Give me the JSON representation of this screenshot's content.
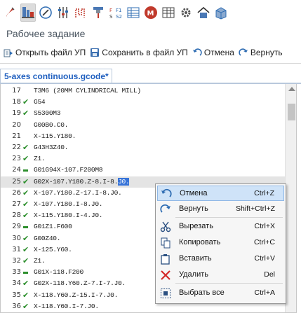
{
  "toolbar_icons": [
    {
      "name": "paint-brush-icon",
      "active": false
    },
    {
      "name": "machine-tool-icon",
      "active": true
    },
    {
      "name": "compass-gauge-icon",
      "active": false
    },
    {
      "name": "sliders-icon",
      "active": false
    },
    {
      "name": "toolpath-icon",
      "active": false
    },
    {
      "name": "tool-holder-icon",
      "active": false
    },
    {
      "name": "feed-speed-icon",
      "active": false
    },
    {
      "name": "table-list-icon",
      "active": false
    },
    {
      "name": "m-code-icon",
      "active": false
    },
    {
      "name": "table-grid-icon",
      "active": false
    },
    {
      "name": "gear-settings-icon",
      "active": false
    },
    {
      "name": "house-icon",
      "active": false
    },
    {
      "name": "stock-block-icon",
      "active": false
    }
  ],
  "section_title": "Рабочее задание",
  "actions": {
    "open": "Открыть файл УП",
    "save": "Сохранить в файл УП",
    "undo": "Отмена",
    "redo": "Вернуть"
  },
  "tab": {
    "title": "5-axes continuous.gcode*"
  },
  "editor": {
    "lines": [
      {
        "num": "17",
        "mark": "",
        "code": "T3M6 (20MM CYLINDRICAL MILL)"
      },
      {
        "num": "18",
        "mark": "ok",
        "code": "G54"
      },
      {
        "num": "19",
        "mark": "ok",
        "code": "S5300M3"
      },
      {
        "num": "20",
        "mark": "",
        "code": "G00B0.C0."
      },
      {
        "num": "21",
        "mark": "",
        "code": "X-115.Y180."
      },
      {
        "num": "22",
        "mark": "ok",
        "code": "G43H3Z40."
      },
      {
        "num": "23",
        "mark": "ok",
        "code": "Z1."
      },
      {
        "num": "24",
        "mark": "dash",
        "code": "G01G94X-107.F200M8"
      },
      {
        "num": "25",
        "mark": "ok",
        "code": "G02X-107.Y180.Z-8.I-8.",
        "selected": "J0."
      },
      {
        "num": "26",
        "mark": "ok",
        "code": "X-107.Y180.Z-17.I-8.J0."
      },
      {
        "num": "27",
        "mark": "ok",
        "code": "X-107.Y180.I-8.J0."
      },
      {
        "num": "28",
        "mark": "ok",
        "code": "X-115.Y180.I-4.J0."
      },
      {
        "num": "29",
        "mark": "dash",
        "code": "G01Z1.F600"
      },
      {
        "num": "30",
        "mark": "ok",
        "code": "G00Z40."
      },
      {
        "num": "31",
        "mark": "ok",
        "code": "X-125.Y60."
      },
      {
        "num": "32",
        "mark": "ok",
        "code": "Z1."
      },
      {
        "num": "33",
        "mark": "dash",
        "code": "G01X-118.F200"
      },
      {
        "num": "34",
        "mark": "ok",
        "code": "G02X-118.Y60.Z-7.I-7.J0."
      },
      {
        "num": "35",
        "mark": "ok",
        "code": "X-118.Y60.Z-15.I-7.J0."
      },
      {
        "num": "36",
        "mark": "ok",
        "code": "X-118.Y60.I-7.J0."
      }
    ],
    "current_line": "25"
  },
  "context_menu": {
    "items": [
      {
        "name": "menu-undo",
        "icon": "undo-icon",
        "label": "Отмена",
        "shortcut": "Ctrl+Z",
        "hover": true
      },
      {
        "name": "menu-redo",
        "icon": "redo-icon",
        "label": "Вернуть",
        "shortcut": "Shift+Ctrl+Z"
      },
      {
        "name": "menu-cut",
        "icon": "scissors-icon",
        "label": "Вырезать",
        "shortcut": "Ctrl+X"
      },
      {
        "name": "menu-copy",
        "icon": "copy-icon",
        "label": "Копировать",
        "shortcut": "Ctrl+C"
      },
      {
        "name": "menu-paste",
        "icon": "paste-icon",
        "label": "Вставить",
        "shortcut": "Ctrl+V"
      },
      {
        "name": "menu-delete",
        "icon": "delete-x-icon",
        "label": "Удалить",
        "shortcut": "Del"
      },
      {
        "name": "menu-select-all",
        "icon": "select-all-icon",
        "label": "Выбрать все",
        "shortcut": "Ctrl+A"
      }
    ]
  },
  "colors": {
    "accent": "#1f5fbf",
    "selection": "#3874d8",
    "check_green": "#2d8f2d",
    "menu_hover": "#cfe3f8",
    "delete_red": "#d42a2a"
  }
}
